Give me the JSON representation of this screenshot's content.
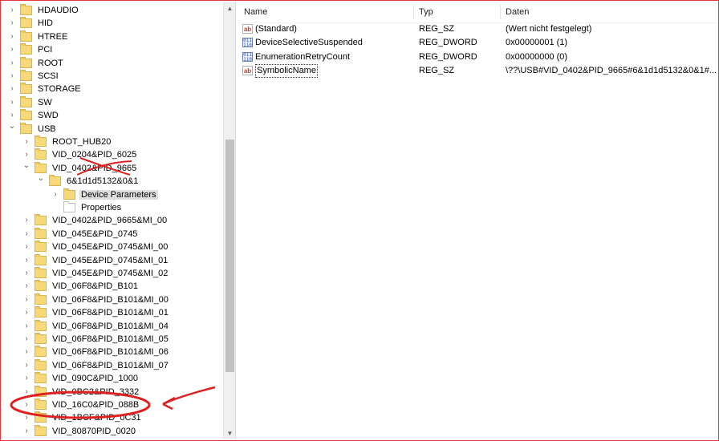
{
  "tree": {
    "items": [
      {
        "label": "HDAUDIO",
        "level": 0,
        "expander": ">",
        "folder": "yellow"
      },
      {
        "label": "HID",
        "level": 0,
        "expander": ">",
        "folder": "yellow"
      },
      {
        "label": "HTREE",
        "level": 0,
        "expander": ">",
        "folder": "yellow"
      },
      {
        "label": "PCI",
        "level": 0,
        "expander": ">",
        "folder": "yellow"
      },
      {
        "label": "ROOT",
        "level": 0,
        "expander": ">",
        "folder": "yellow"
      },
      {
        "label": "SCSI",
        "level": 0,
        "expander": ">",
        "folder": "yellow"
      },
      {
        "label": "STORAGE",
        "level": 0,
        "expander": ">",
        "folder": "yellow"
      },
      {
        "label": "SW",
        "level": 0,
        "expander": ">",
        "folder": "yellow"
      },
      {
        "label": "SWD",
        "level": 0,
        "expander": ">",
        "folder": "yellow"
      },
      {
        "label": "USB",
        "level": 0,
        "expander": "v",
        "folder": "yellow"
      },
      {
        "label": "ROOT_HUB20",
        "level": 1,
        "expander": ">",
        "folder": "yellow"
      },
      {
        "label": "VID_0204&PID_6025",
        "level": 1,
        "expander": ">",
        "folder": "yellow"
      },
      {
        "label": "VID_0402&PID_9665",
        "level": 1,
        "expander": "v",
        "folder": "yellow"
      },
      {
        "label": "6&1d1d5132&0&1",
        "level": 2,
        "expander": "v",
        "folder": "yellow"
      },
      {
        "label": "Device Parameters",
        "level": 3,
        "expander": ">",
        "folder": "yellow",
        "selected": true
      },
      {
        "label": "Properties",
        "level": 3,
        "expander": "",
        "folder": "white"
      },
      {
        "label": "VID_0402&PID_9665&MI_00",
        "level": 1,
        "expander": ">",
        "folder": "yellow"
      },
      {
        "label": "VID_045E&PID_0745",
        "level": 1,
        "expander": ">",
        "folder": "yellow"
      },
      {
        "label": "VID_045E&PID_0745&MI_00",
        "level": 1,
        "expander": ">",
        "folder": "yellow"
      },
      {
        "label": "VID_045E&PID_0745&MI_01",
        "level": 1,
        "expander": ">",
        "folder": "yellow"
      },
      {
        "label": "VID_045E&PID_0745&MI_02",
        "level": 1,
        "expander": ">",
        "folder": "yellow"
      },
      {
        "label": "VID_06F8&PID_B101",
        "level": 1,
        "expander": ">",
        "folder": "yellow"
      },
      {
        "label": "VID_06F8&PID_B101&MI_00",
        "level": 1,
        "expander": ">",
        "folder": "yellow"
      },
      {
        "label": "VID_06F8&PID_B101&MI_01",
        "level": 1,
        "expander": ">",
        "folder": "yellow"
      },
      {
        "label": "VID_06F8&PID_B101&MI_04",
        "level": 1,
        "expander": ">",
        "folder": "yellow"
      },
      {
        "label": "VID_06F8&PID_B101&MI_05",
        "level": 1,
        "expander": ">",
        "folder": "yellow"
      },
      {
        "label": "VID_06F8&PID_B101&MI_06",
        "level": 1,
        "expander": ">",
        "folder": "yellow"
      },
      {
        "label": "VID_06F8&PID_B101&MI_07",
        "level": 1,
        "expander": ">",
        "folder": "yellow"
      },
      {
        "label": "VID_090C&PID_1000",
        "level": 1,
        "expander": ">",
        "folder": "yellow"
      },
      {
        "label": "VID_0BC2&PID_3332",
        "level": 1,
        "expander": ">",
        "folder": "yellow"
      },
      {
        "label": "VID_16C0&PID_088B",
        "level": 1,
        "expander": ">",
        "folder": "yellow"
      },
      {
        "label": "VID_1BCF&PID_0C31",
        "level": 1,
        "expander": ">",
        "folder": "yellow"
      },
      {
        "label": "VID_80870PID_0020",
        "level": 1,
        "expander": ">",
        "folder": "yellow"
      }
    ]
  },
  "values": {
    "columns": {
      "name": "Name",
      "type": "Typ",
      "data": "Daten"
    },
    "rows": [
      {
        "name": "(Standard)",
        "type": "REG_SZ",
        "data": "(Wert nicht festgelegt)",
        "icon": "ab-icon"
      },
      {
        "name": "DeviceSelectiveSuspended",
        "type": "REG_DWORD",
        "data": "0x00000001 (1)",
        "icon": "binary-icon"
      },
      {
        "name": "EnumerationRetryCount",
        "type": "REG_DWORD",
        "data": "0x00000000 (0)",
        "icon": "binary-icon"
      },
      {
        "name": "SymbolicName",
        "type": "REG_SZ",
        "data": "\\??\\USB#VID_0402&PID_9665#6&1d1d5132&0&1#...",
        "icon": "ab-icon",
        "focused": true
      }
    ]
  },
  "colors": {
    "annotation_red": "#e02020",
    "folder": "#f8d979",
    "selection": "#dedede"
  },
  "icons": {
    "expand": "chevron-right",
    "collapse": "chevron-down"
  }
}
